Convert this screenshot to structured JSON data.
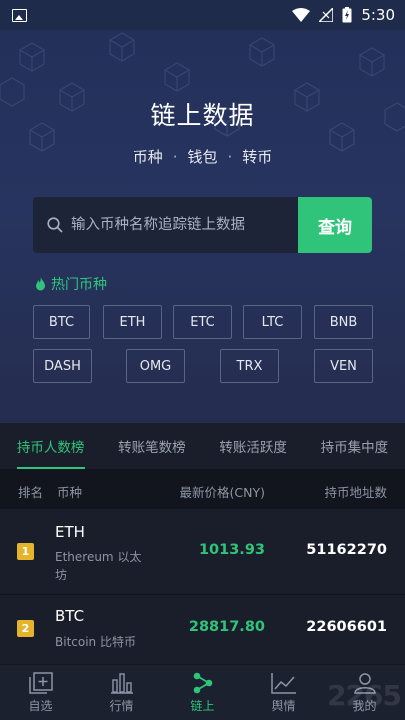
{
  "status_bar": {
    "time": "5:30"
  },
  "hero": {
    "title": "链上数据",
    "subtitle": [
      "币种",
      "钱包",
      "转币"
    ],
    "separator": "·"
  },
  "search": {
    "placeholder": "输入币种名称追踪链上数据",
    "button_label": "查询"
  },
  "hot": {
    "heading": "热门币种",
    "tags": [
      "BTC",
      "ETH",
      "ETC",
      "LTC",
      "BNB",
      "DASH",
      "OMG",
      "TRX",
      "VEN"
    ]
  },
  "tabs": [
    "持币人数榜",
    "转账笔数榜",
    "转账活跃度",
    "持币集中度"
  ],
  "table": {
    "headers": {
      "rank": "排名",
      "coin": "币种",
      "price": "最新价格(CNY)",
      "addresses": "持币地址数"
    },
    "rows": [
      {
        "rank": "1",
        "symbol": "ETH",
        "name": "Ethereum 以太坊",
        "price": "1013.93",
        "addresses": "51162270"
      },
      {
        "rank": "2",
        "symbol": "BTC",
        "name": "Bitcoin 比特币",
        "price": "28817.80",
        "addresses": "22606601"
      }
    ]
  },
  "bottom_nav": [
    "自选",
    "行情",
    "链上",
    "舆情",
    "我的"
  ],
  "watermark": "2265",
  "colors": {
    "accent": "#2fc47a",
    "rank_badge": "#e6b42a",
    "hero_bg": "#27345f"
  }
}
